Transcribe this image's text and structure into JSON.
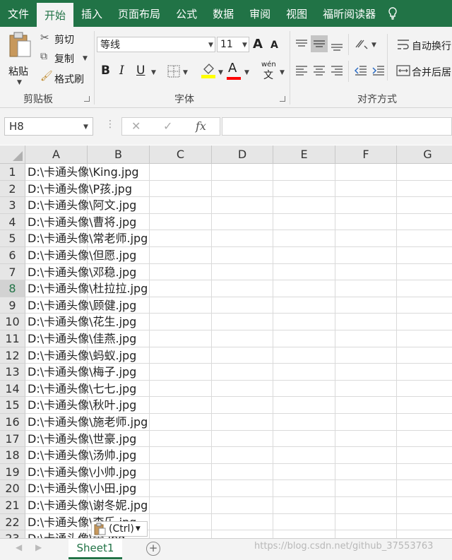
{
  "tabs": [
    "文件",
    "开始",
    "插入",
    "页面布局",
    "公式",
    "数据",
    "审阅",
    "视图",
    "福昕阅读器"
  ],
  "active_tab": "开始",
  "clipboard": {
    "paste": "粘贴",
    "cut": "剪切",
    "copy": "复制",
    "format_painter": "格式刷",
    "group": "剪贴板"
  },
  "font": {
    "name": "等线",
    "size": "11",
    "bold": "B",
    "italic": "I",
    "underline": "U",
    "grow": "A",
    "shrink": "A",
    "group": "字体",
    "wen": "wén",
    "wen2": "文",
    "font_color": "A"
  },
  "alignment": {
    "wrap": "自动换行",
    "merge": "合并后居",
    "group": "对齐方式"
  },
  "formula_bar": {
    "name_box": "H8",
    "cancel": "✕",
    "enter": "✓",
    "fx": "fx",
    "value": ""
  },
  "columns": [
    "A",
    "B",
    "C",
    "D",
    "E",
    "F",
    "G"
  ],
  "rows": [
    {
      "n": "1",
      "a": "D:\\卡通头像\\King.jpg"
    },
    {
      "n": "2",
      "a": "D:\\卡通头像\\P孩.jpg"
    },
    {
      "n": "3",
      "a": "D:\\卡通头像\\阿文.jpg"
    },
    {
      "n": "4",
      "a": "D:\\卡通头像\\曹将.jpg"
    },
    {
      "n": "5",
      "a": "D:\\卡通头像\\常老师.jpg"
    },
    {
      "n": "6",
      "a": "D:\\卡通头像\\但愿.jpg"
    },
    {
      "n": "7",
      "a": "D:\\卡通头像\\邓稳.jpg"
    },
    {
      "n": "8",
      "a": "D:\\卡通头像\\杜拉拉.jpg"
    },
    {
      "n": "9",
      "a": "D:\\卡通头像\\顾健.jpg"
    },
    {
      "n": "10",
      "a": "D:\\卡通头像\\花生.jpg"
    },
    {
      "n": "11",
      "a": "D:\\卡通头像\\佳燕.jpg"
    },
    {
      "n": "12",
      "a": "D:\\卡通头像\\蚂蚁.jpg"
    },
    {
      "n": "13",
      "a": "D:\\卡通头像\\梅子.jpg"
    },
    {
      "n": "14",
      "a": "D:\\卡通头像\\七七.jpg"
    },
    {
      "n": "15",
      "a": "D:\\卡通头像\\秋叶.jpg"
    },
    {
      "n": "16",
      "a": "D:\\卡通头像\\施老师.jpg"
    },
    {
      "n": "17",
      "a": "D:\\卡通头像\\世豪.jpg"
    },
    {
      "n": "18",
      "a": "D:\\卡通头像\\汤帅.jpg"
    },
    {
      "n": "19",
      "a": "D:\\卡通头像\\小帅.jpg"
    },
    {
      "n": "20",
      "a": "D:\\卡通头像\\小田.jpg"
    },
    {
      "n": "21",
      "a": "D:\\卡通头像\\谢冬妮.jpg"
    },
    {
      "n": "22",
      "a": "D:\\卡通头像\\李乐.jpg"
    },
    {
      "n": "23",
      "a": "D:\\卡通头像\\李.jpg"
    }
  ],
  "selected_row": "8",
  "paste_options": "(Ctrl)",
  "sheet_tab": "Sheet1",
  "add_sheet": "+",
  "watermark": "https://blog.csdn.net/github_37553763",
  "colors": {
    "accent": "#217346",
    "ribbon_bg": "#f3f3f3",
    "yellow": "#ffff00",
    "red": "#ff0000"
  }
}
